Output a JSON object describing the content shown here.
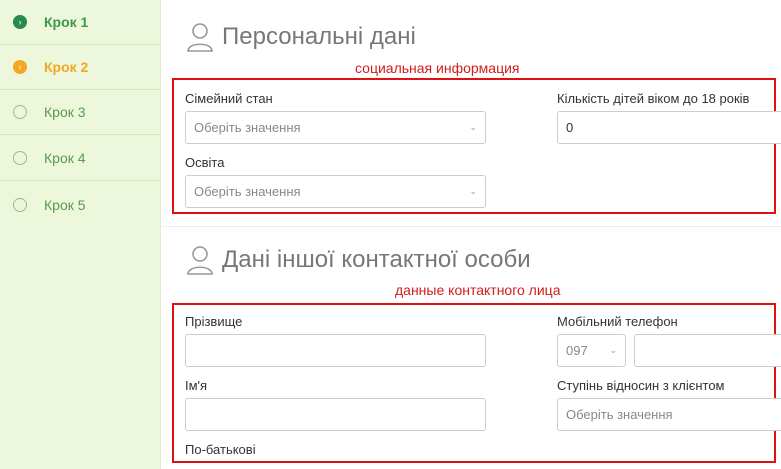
{
  "sidebar": {
    "steps": [
      {
        "label": "Крок 1",
        "state": "done",
        "marker": "›"
      },
      {
        "label": "Крок 2",
        "state": "active",
        "marker": "›"
      },
      {
        "label": "Крок 3",
        "state": "todo"
      },
      {
        "label": "Крок 4",
        "state": "todo"
      },
      {
        "label": "Крок 5",
        "state": "todo"
      }
    ]
  },
  "personal": {
    "title": "Персональні дані",
    "annotation": "социальная информация",
    "marital_label": "Сімейний стан",
    "marital_placeholder": "Оберіть значення",
    "children_label": "Кількість дітей віком до 18 років",
    "children_value": "0",
    "education_label": "Освіта",
    "education_placeholder": "Оберіть значення"
  },
  "contact": {
    "title": "Дані іншої контактної особи",
    "annotation": "данные контактного лица",
    "surname_label": "Прізвище",
    "surname_value": "",
    "name_label": "Ім'я",
    "name_value": "",
    "patronymic_label": "По-батькові",
    "phone_label": "Мобільний телефон",
    "phone_code": "097",
    "phone_number": "",
    "relation_label": "Ступінь відносин з клієнтом",
    "relation_placeholder": "Оберіть значення"
  },
  "colors": {
    "sidebar_bg": "#edf7dc",
    "done": "#2a8a4b",
    "active": "#f5a623",
    "annotation_red": "#e01010"
  }
}
